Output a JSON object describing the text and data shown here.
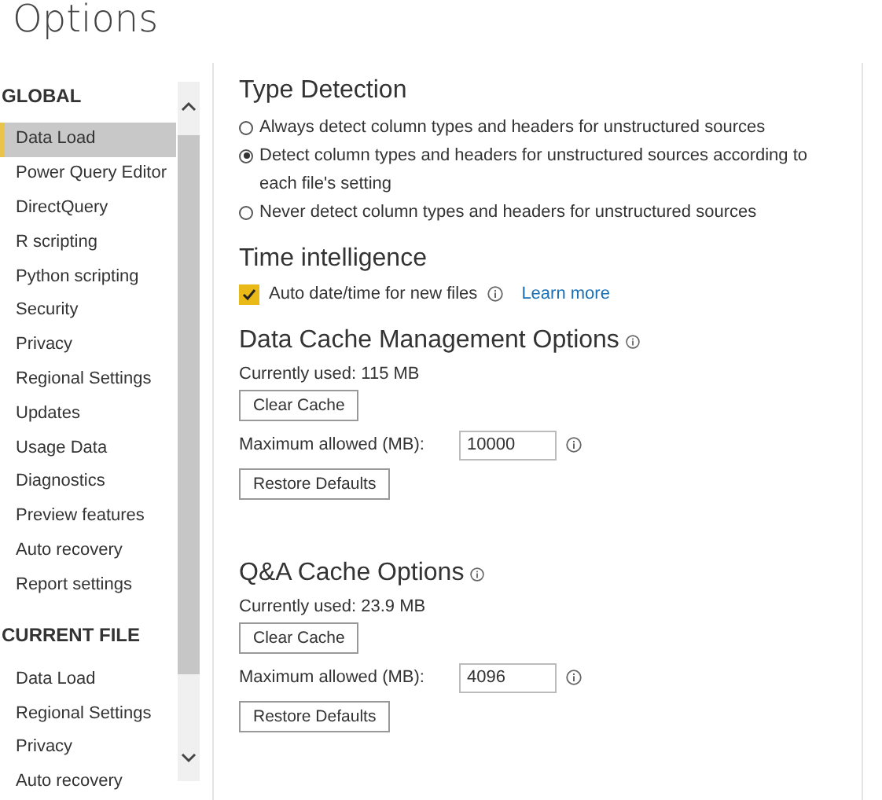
{
  "title": "Options",
  "sidebar": {
    "sections": [
      {
        "heading": "GLOBAL",
        "items": [
          {
            "label": "Data Load",
            "selected": true
          },
          {
            "label": "Power Query Editor",
            "selected": false
          },
          {
            "label": "DirectQuery",
            "selected": false
          },
          {
            "label": "R scripting",
            "selected": false
          },
          {
            "label": "Python scripting",
            "selected": false
          },
          {
            "label": "Security",
            "selected": false
          },
          {
            "label": "Privacy",
            "selected": false
          },
          {
            "label": "Regional Settings",
            "selected": false
          },
          {
            "label": "Updates",
            "selected": false
          },
          {
            "label": "Usage Data",
            "selected": false
          },
          {
            "label": "Diagnostics",
            "selected": false
          },
          {
            "label": "Preview features",
            "selected": false
          },
          {
            "label": "Auto recovery",
            "selected": false
          },
          {
            "label": "Report settings",
            "selected": false
          }
        ]
      },
      {
        "heading": "CURRENT FILE",
        "items": [
          {
            "label": "Data Load",
            "selected": false
          },
          {
            "label": "Regional Settings",
            "selected": false
          },
          {
            "label": "Privacy",
            "selected": false
          },
          {
            "label": "Auto recovery",
            "selected": false
          }
        ]
      }
    ]
  },
  "type_detection": {
    "heading": "Type Detection",
    "options": [
      {
        "label": "Always detect column types and headers for unstructured sources",
        "selected": false
      },
      {
        "label": "Detect column types and headers for unstructured sources according to each file's setting",
        "selected": true
      },
      {
        "label": "Never detect column types and headers for unstructured sources",
        "selected": false
      }
    ]
  },
  "time_intelligence": {
    "heading": "Time intelligence",
    "checkbox": {
      "label": "Auto date/time for new files",
      "checked": true
    },
    "link": "Learn more"
  },
  "caches": [
    {
      "heading": "Data Cache Management Options",
      "used": "Currently used: 115 MB",
      "clear_button": "Clear Cache",
      "max_label": "Maximum allowed (MB):",
      "max_value": "10000",
      "restore_button": "Restore Defaults"
    },
    {
      "heading": "Q&A Cache Options",
      "used": "Currently used: 23.9 MB",
      "clear_button": "Clear Cache",
      "max_label": "Maximum allowed (MB):",
      "max_value": "4096",
      "restore_button": "Restore Defaults"
    }
  ]
}
